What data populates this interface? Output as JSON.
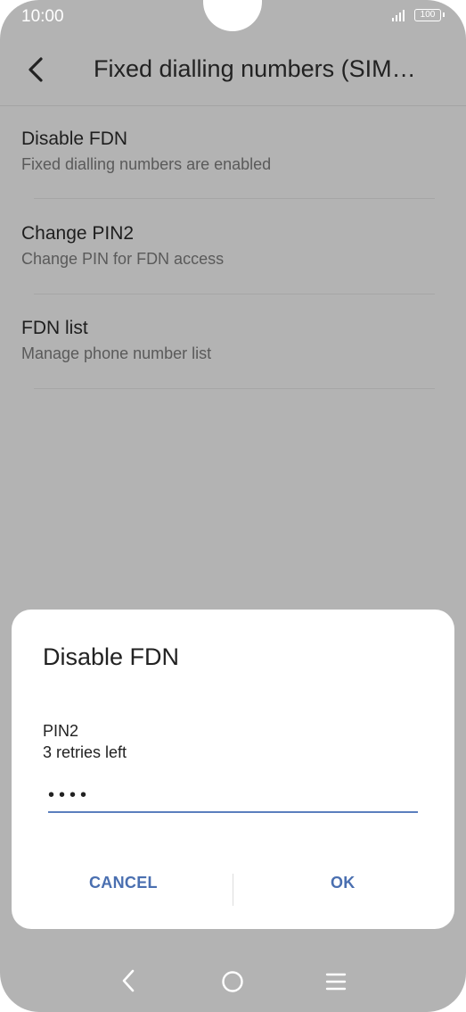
{
  "status_bar": {
    "time": "10:00",
    "battery": "100"
  },
  "header": {
    "title": "Fixed dialling numbers (SIM…"
  },
  "list": {
    "items": [
      {
        "title": "Disable FDN",
        "subtitle": "Fixed dialling numbers are enabled"
      },
      {
        "title": "Change PIN2",
        "subtitle": "Change PIN for FDN access"
      },
      {
        "title": "FDN list",
        "subtitle": "Manage phone number list"
      }
    ]
  },
  "dialog": {
    "title": "Disable FDN",
    "field_label": "PIN2",
    "retries": "3 retries left",
    "pin_value": "••••",
    "cancel_label": "CANCEL",
    "ok_label": "OK"
  },
  "colors": {
    "accent": "#4a6fb0",
    "scrim": "#b3b3b3"
  },
  "nav_bar": {
    "icons": [
      "back-icon",
      "home-icon",
      "menu-icon"
    ]
  }
}
